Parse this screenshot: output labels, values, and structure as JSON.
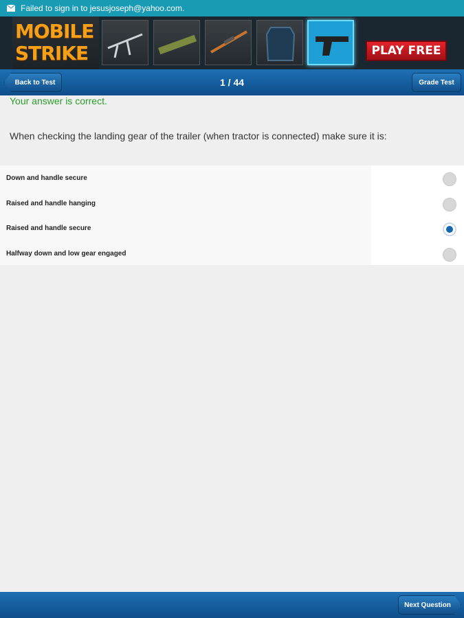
{
  "status_bar": {
    "message": "Failed to sign in to jesusjoseph@yahoo.com."
  },
  "ad": {
    "logo_line1": "MOBILE",
    "logo_line2": "STRIKE",
    "cta": "PLAY FREE",
    "items": [
      "rifle-icon",
      "rocket-launcher-icon",
      "sniper-rifle-icon",
      "body-armor-icon",
      "pistol-icon"
    ]
  },
  "nav": {
    "back_label": "Back to Test",
    "title": "1 / 44",
    "grade_label": "Grade Test"
  },
  "feedback": "Your answer is correct.",
  "question": "When checking the landing gear of the trailer (when tractor is connected) make sure it is:",
  "options": [
    {
      "label": "Down and handle secure",
      "selected": false
    },
    {
      "label": "Raised and handle hanging",
      "selected": false
    },
    {
      "label": "Raised and handle secure",
      "selected": true
    },
    {
      "label": "Halfway down and low gear engaged",
      "selected": false
    }
  ],
  "footer": {
    "next_label": "Next Question"
  },
  "colors": {
    "nav": "#1d6fb3",
    "status": "#1a9bb5",
    "correct": "#2b9d2b",
    "radio_selected": "#1565b0"
  }
}
